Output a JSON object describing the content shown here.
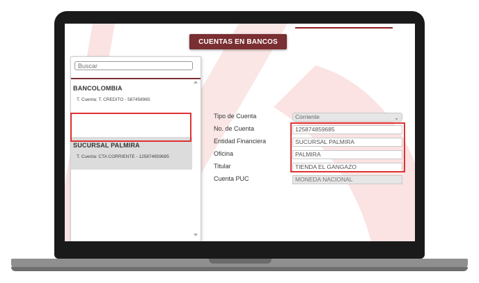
{
  "app": {
    "title": "CUENTAS EN BANCOS",
    "accent_color": "#7a2f32",
    "highlight_color": "#e03131"
  },
  "search": {
    "placeholder": "Buscar"
  },
  "accounts": [
    {
      "name": "BANCOLOMBIA",
      "detail": "T. Cuenta: T. CREDITO - 587458965"
    },
    {
      "name": "SUCURSAL PALMIRA",
      "detail": "T. Cuenta: CTA CORRIENTE - 125874859685"
    }
  ],
  "form": {
    "tipo_cuenta": {
      "label": "Tipo de Cuenta",
      "value": "Corriente"
    },
    "no_cuenta": {
      "label": "No. de Cuenta",
      "value": "125874859685"
    },
    "entidad": {
      "label": "Entidad Financiera",
      "value": "SUCURSAL PALMIRA"
    },
    "oficina": {
      "label": "Oficina",
      "value": "PALMIRA"
    },
    "titular": {
      "label": "Titular",
      "value": "TIENDA EL GANGAZO"
    },
    "cuenta_puc": {
      "label": "Cuenta PUC",
      "value": "MONEDA NACIONAL"
    }
  }
}
